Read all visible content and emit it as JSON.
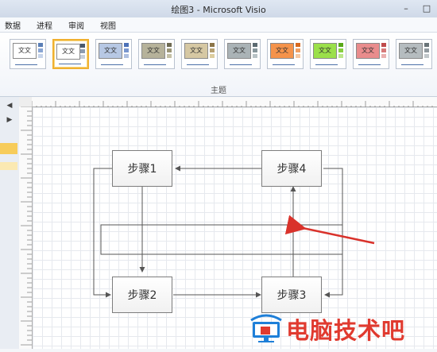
{
  "window": {
    "title": "绘图3 - Microsoft Visio"
  },
  "menu": [
    "数据",
    "进程",
    "审阅",
    "视图"
  ],
  "ribbon": {
    "group_label": "主题",
    "themes": [
      {
        "label": "文文",
        "fill": "#ffffff",
        "dots": [
          "#5b7fb6",
          "#8aa6d4",
          "#c6d4ea"
        ]
      },
      {
        "label": "文文",
        "fill": "#ffffff",
        "dots": [
          "#4a5a6d",
          "#8c9bb0",
          "#c7cfda"
        ],
        "selected": true
      },
      {
        "label": "文文",
        "fill": "#b7c8e4",
        "dots": [
          "#4e72b8",
          "#7a97cf",
          "#aebfe0"
        ]
      },
      {
        "label": "文文",
        "fill": "#b6b29a",
        "dots": [
          "#6e6a52",
          "#9b9678",
          "#c4c0a6"
        ]
      },
      {
        "label": "文文",
        "fill": "#d6c8a3",
        "dots": [
          "#8c7548",
          "#b6a173",
          "#dccd9f"
        ]
      },
      {
        "label": "文文",
        "fill": "#aab3b6",
        "dots": [
          "#5c6a70",
          "#88979c",
          "#b8c2c5"
        ]
      },
      {
        "label": "文文",
        "fill": "#f5934a",
        "dots": [
          "#d86a1f",
          "#f0a064",
          "#f6c8a2"
        ]
      },
      {
        "label": "文文",
        "fill": "#9be04a",
        "dots": [
          "#58a818",
          "#88cf40",
          "#bbe68a"
        ]
      },
      {
        "label": "文文",
        "fill": "#e98c8c",
        "dots": [
          "#c04b4b",
          "#d77a7a",
          "#eab0b0"
        ]
      },
      {
        "label": "文文",
        "fill": "#b5bcbf",
        "dots": [
          "#6a7478",
          "#929ba0",
          "#c1c7ca"
        ]
      }
    ]
  },
  "steps": [
    "步骤1",
    "步骤4",
    "步骤2",
    "步骤3"
  ],
  "watermark": {
    "text": "电脑技术吧"
  },
  "colors": {
    "arrow_red": "#d9322b",
    "connector": "#555555"
  }
}
